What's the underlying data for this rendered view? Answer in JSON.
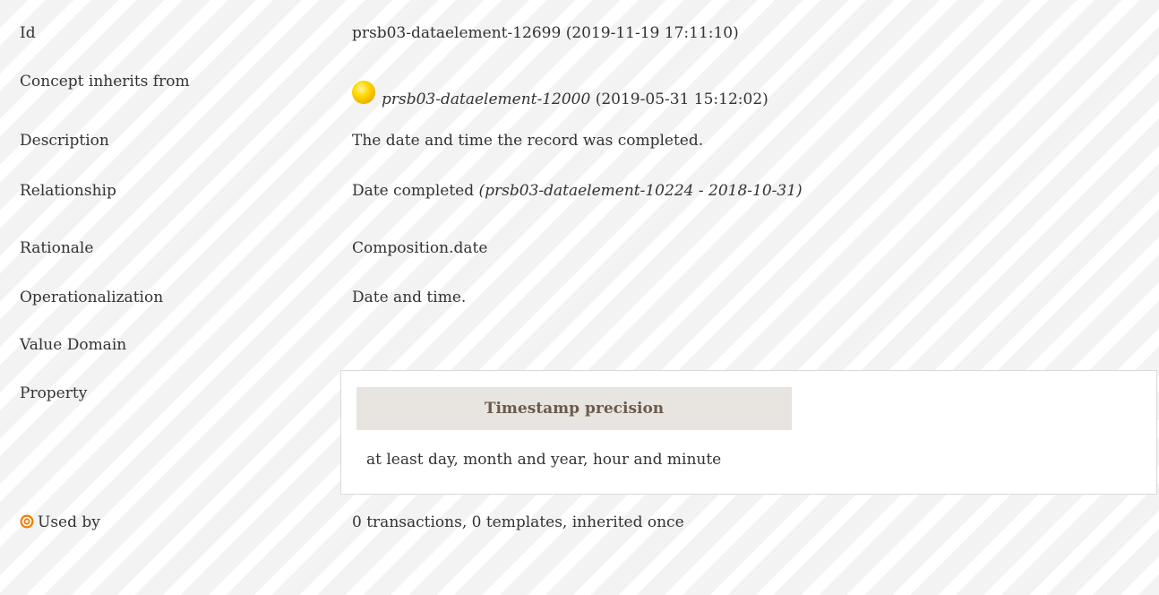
{
  "rows": {
    "id": {
      "label": "Id",
      "value": "prsb03-dataelement-12699 (2019-11-19 17:11:10)"
    },
    "inherits": {
      "label": "Concept inherits from",
      "ref": "prsb03-dataelement-12000",
      "date": " (2019-05-31 15:12:02)",
      "icon": "status-orb-icon"
    },
    "description": {
      "label": "Description",
      "value": "The date and time the record was completed."
    },
    "relationship": {
      "label": "Relationship",
      "value": "Date completed",
      "ref": "(prsb03-dataelement-10224 - 2018-10-31)"
    },
    "rationale": {
      "label": "Rationale",
      "value": "Composition.date"
    },
    "operationalization": {
      "label": "Operationalization",
      "value": "Date and time."
    },
    "value_domain": {
      "label": "Value Domain"
    },
    "property": {
      "label": "Property",
      "header": "Timestamp precision",
      "value": "at least day, month and year, hour and minute"
    },
    "used_by": {
      "label": "Used by",
      "value": "0 transactions, 0 templates, inherited once",
      "icon": "target-icon"
    }
  },
  "colors": {
    "stripe_dark": "#f3f3f3",
    "stripe_light": "#ffffff",
    "header_bg": "#e8e4df",
    "header_text": "#6b5b4e",
    "target_orange": "#f07d00",
    "orb_yellow": "#ffd900"
  }
}
